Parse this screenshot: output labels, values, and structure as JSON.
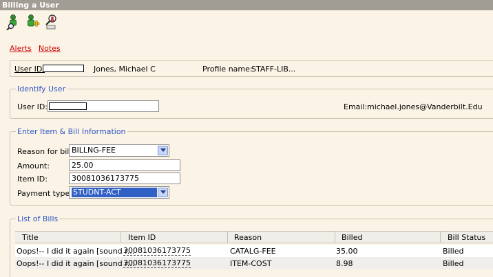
{
  "window": {
    "title": "Billing a User"
  },
  "toolbar": {
    "icons": [
      "find-user-icon",
      "add-user-icon",
      "user-search-icon"
    ]
  },
  "links": {
    "alerts": "Alerts",
    "notes": "Notes"
  },
  "userbar": {
    "user_id_label": "User ID:",
    "user_name": "Jones, Michael C",
    "profile_label": "Profile name:",
    "profile_value": "STAFF-LIB..."
  },
  "identify": {
    "title": "Identify User",
    "user_id_label": "User ID:",
    "email_label": "Email:",
    "email_value": "michael.jones@Vanderbilt.Edu"
  },
  "bill_info": {
    "title": "Enter Item & Bill Information",
    "reason_label": "Reason for bill:",
    "reason_value": "BILLNG-FEE",
    "amount_label": "Amount:",
    "amount_value": "25.00",
    "item_id_label": "Item ID:",
    "item_id_value": "30081036173775",
    "payment_label": "Payment type:",
    "payment_value": "STUDNT-ACT"
  },
  "bills": {
    "title": "List of Bills",
    "columns": [
      "Title",
      "Item ID",
      "Reason",
      "Billed",
      "Bill Status"
    ],
    "rows": [
      [
        "Oops!-- I did it again [sound r...",
        "30081036173775",
        "CATALG-FEE",
        "35.00",
        "Billed"
      ],
      [
        "Oops!-- I did it again [sound r...",
        "30081036173775",
        "ITEM-COST",
        "8.98",
        "Billed"
      ]
    ]
  },
  "colors": {
    "accent": "#2f55c4",
    "link": "#cc0000",
    "background": "#fbf4e6",
    "selection": "#3161c5"
  }
}
